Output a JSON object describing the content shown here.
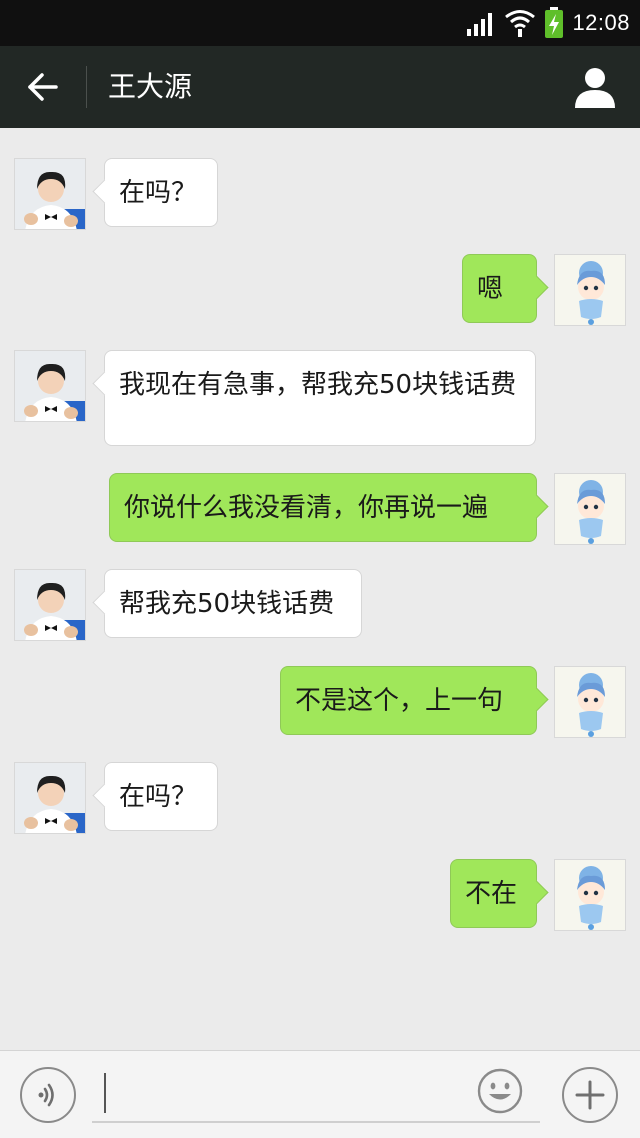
{
  "status_bar": {
    "time": "12:08",
    "icons": [
      "signal-icon",
      "wifi-icon",
      "battery-charging-icon"
    ]
  },
  "header": {
    "back_icon": "arrow-left-icon",
    "title": "王大源",
    "profile_icon": "person-icon"
  },
  "messages": [
    {
      "side": "in",
      "text": "在吗？"
    },
    {
      "side": "out",
      "text": "嗯"
    },
    {
      "side": "in",
      "text": "我现在有急事，帮我充50块钱话费"
    },
    {
      "side": "out",
      "text": "你说什么我没看清，你再说一遍"
    },
    {
      "side": "in",
      "text": "帮我充50块钱话费"
    },
    {
      "side": "out",
      "text": "不是这个，上一句"
    },
    {
      "side": "in",
      "text": "在吗？"
    },
    {
      "side": "out",
      "text": "不在"
    }
  ],
  "input_bar": {
    "voice_icon": "voice-icon",
    "input_value": "",
    "emoji_icon": "emoji-icon",
    "plus_icon": "plus-icon"
  },
  "colors": {
    "status_bar": "#101010",
    "nav_bar": "#222825",
    "chat_bg": "#ebebeb",
    "bubble_out": "#a0e75a",
    "bubble_in": "#ffffff"
  }
}
